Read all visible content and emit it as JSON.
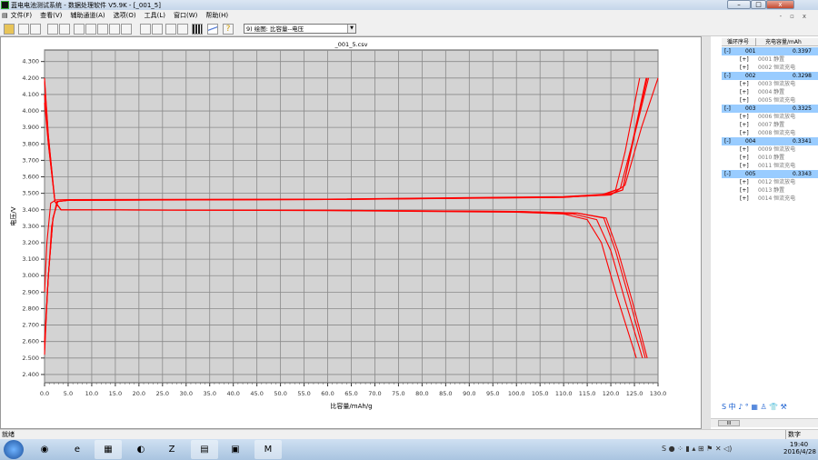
{
  "window": {
    "title": "蓝电电池测试系统 - 数据处理软件 V5.9K - [_001_5]",
    "min": "–",
    "max": "□",
    "close": "x",
    "child_min": "-",
    "child_restore": "▫",
    "child_close": "x"
  },
  "menu": [
    "文件(F)",
    "查看(V)",
    "辅助通道(A)",
    "选项(O)",
    "工具(L)",
    "窗口(W)",
    "帮助(H)"
  ],
  "toolbar": {
    "icons": [
      "open-icon",
      "back-icon",
      "forward-icon",
      "zoom-icon",
      "hand-icon",
      "h-expand-icon",
      "h-shrink-icon",
      "fit-width-icon",
      "fit-height-icon",
      "fit-all-icon",
      "copy-icon",
      "paste-icon",
      "copy2-icon",
      "paste2-icon",
      "grid-icon",
      "curve-icon",
      "help-icon"
    ],
    "plot_select": "9) 绘图: 比容量--电压"
  },
  "chart_data": {
    "type": "line",
    "title": "_001_5.csv",
    "xlabel": "比容量/mAh/g",
    "ylabel": "电压/V",
    "xlim": [
      0,
      130
    ],
    "ylim": [
      2.35,
      4.37
    ],
    "xticks": [
      "0.0",
      "5.0",
      "10.0",
      "15.0",
      "20.0",
      "25.0",
      "30.0",
      "35.0",
      "40.0",
      "45.0",
      "50.0",
      "55.0",
      "60.0",
      "65.0",
      "70.0",
      "75.0",
      "80.0",
      "85.0",
      "90.0",
      "95.0",
      "100.0",
      "105.0",
      "110.0",
      "115.0",
      "120.0",
      "125.0",
      "130.0"
    ],
    "yticks": [
      "2.400",
      "2.500",
      "2.600",
      "2.700",
      "2.800",
      "2.900",
      "3.000",
      "3.100",
      "3.200",
      "3.300",
      "3.400",
      "3.500",
      "3.600",
      "3.700",
      "3.800",
      "3.900",
      "4.000",
      "4.100",
      "4.200",
      "4.300"
    ],
    "grid": true,
    "color": "#ff0000",
    "background": "#d3d3d3",
    "series": [
      {
        "points": [
          [
            0,
            2.52
          ],
          [
            0.6,
            2.9
          ],
          [
            1.5,
            3.3
          ],
          [
            2.6,
            3.45
          ],
          [
            5,
            3.458
          ],
          [
            60,
            3.462
          ],
          [
            110,
            3.475
          ],
          [
            118,
            3.49
          ],
          [
            121,
            3.52
          ],
          [
            123,
            3.75
          ],
          [
            126.1,
            4.2
          ]
        ]
      },
      {
        "points": [
          [
            0,
            2.9
          ],
          [
            0.5,
            3.2
          ],
          [
            1.3,
            3.44
          ],
          [
            2.4,
            3.46
          ],
          [
            5,
            3.462
          ],
          [
            60,
            3.465
          ],
          [
            110,
            3.48
          ],
          [
            119,
            3.495
          ],
          [
            122,
            3.53
          ],
          [
            124.5,
            3.8
          ],
          [
            127.7,
            4.2
          ]
        ]
      },
      {
        "points": [
          [
            0,
            2.6
          ],
          [
            0.8,
            3.0
          ],
          [
            1.8,
            3.35
          ],
          [
            2.8,
            3.45
          ],
          [
            5,
            3.458
          ],
          [
            60,
            3.462
          ],
          [
            110,
            3.477
          ],
          [
            119,
            3.49
          ],
          [
            122.5,
            3.52
          ],
          [
            125,
            3.85
          ],
          [
            128,
            4.2
          ]
        ]
      },
      {
        "points": [
          [
            0,
            2.55
          ],
          [
            0.8,
            3.0
          ],
          [
            1.8,
            3.35
          ],
          [
            2.8,
            3.45
          ],
          [
            5,
            3.457
          ],
          [
            60,
            3.462
          ],
          [
            110,
            3.476
          ],
          [
            120,
            3.49
          ],
          [
            123,
            3.55
          ],
          [
            126.5,
            3.9
          ],
          [
            130,
            4.2
          ]
        ]
      },
      {
        "points": [
          [
            0,
            2.58
          ],
          [
            0.8,
            3.0
          ],
          [
            1.8,
            3.35
          ],
          [
            2.8,
            3.45
          ],
          [
            5,
            3.458
          ],
          [
            60,
            3.463
          ],
          [
            110,
            3.478
          ],
          [
            119.5,
            3.49
          ],
          [
            122.5,
            3.52
          ],
          [
            124.5,
            3.8
          ],
          [
            127.5,
            4.2
          ]
        ]
      },
      {
        "points": [
          [
            0,
            4.2
          ],
          [
            0.8,
            3.85
          ],
          [
            2.2,
            3.45
          ],
          [
            3.5,
            3.4
          ],
          [
            60,
            3.395
          ],
          [
            100,
            3.385
          ],
          [
            110,
            3.375
          ],
          [
            115,
            3.34
          ],
          [
            118,
            3.2
          ],
          [
            121,
            2.9
          ],
          [
            125.4,
            2.5
          ]
        ]
      },
      {
        "points": [
          [
            0,
            4.18
          ],
          [
            0.8,
            3.85
          ],
          [
            2.2,
            3.45
          ],
          [
            3.5,
            3.4
          ],
          [
            60,
            3.396
          ],
          [
            100,
            3.388
          ],
          [
            112,
            3.375
          ],
          [
            117,
            3.34
          ],
          [
            120,
            3.15
          ],
          [
            123,
            2.85
          ],
          [
            126.7,
            2.5
          ]
        ]
      },
      {
        "points": [
          [
            0,
            4.1
          ],
          [
            0.8,
            3.8
          ],
          [
            2.2,
            3.45
          ],
          [
            3.5,
            3.4
          ],
          [
            60,
            3.397
          ],
          [
            100,
            3.39
          ],
          [
            113,
            3.38
          ],
          [
            118.5,
            3.35
          ],
          [
            121,
            3.15
          ],
          [
            124,
            2.85
          ],
          [
            127.3,
            2.5
          ]
        ]
      },
      {
        "points": [
          [
            0,
            4.05
          ],
          [
            0.8,
            3.8
          ],
          [
            2.2,
            3.45
          ],
          [
            3.5,
            3.4
          ],
          [
            60,
            3.397
          ],
          [
            100,
            3.39
          ],
          [
            113,
            3.38
          ],
          [
            119,
            3.35
          ],
          [
            121.5,
            3.15
          ],
          [
            124.5,
            2.85
          ],
          [
            127.7,
            2.5
          ]
        ]
      }
    ]
  },
  "panel": {
    "headers": [
      "循环序号",
      "充电容量/mAh",
      ""
    ],
    "rows": [
      {
        "kind": "group",
        "toggle": "[-]",
        "id": "001",
        "value": "0.3397"
      },
      {
        "kind": "step",
        "toggle": "[+]",
        "label": "0001 静置"
      },
      {
        "kind": "step",
        "toggle": "[+]",
        "label": "0002 恒流充电"
      },
      {
        "kind": "group",
        "toggle": "[-]",
        "id": "002",
        "value": "0.3298"
      },
      {
        "kind": "step",
        "toggle": "[+]",
        "label": "0003 恒流放电"
      },
      {
        "kind": "step",
        "toggle": "[+]",
        "label": "0004 静置"
      },
      {
        "kind": "step",
        "toggle": "[+]",
        "label": "0005 恒流充电"
      },
      {
        "kind": "group",
        "toggle": "[-]",
        "id": "003",
        "value": "0.3325"
      },
      {
        "kind": "step",
        "toggle": "[+]",
        "label": "0006 恒流放电"
      },
      {
        "kind": "step",
        "toggle": "[+]",
        "label": "0007 静置"
      },
      {
        "kind": "step",
        "toggle": "[+]",
        "label": "0008 恒流充电"
      },
      {
        "kind": "group",
        "toggle": "[-]",
        "id": "004",
        "value": "0.3341"
      },
      {
        "kind": "step",
        "toggle": "[+]",
        "label": "0009 恒流放电"
      },
      {
        "kind": "step",
        "toggle": "[+]",
        "label": "0010 静置"
      },
      {
        "kind": "step",
        "toggle": "[+]",
        "label": "0011 恒流充电"
      },
      {
        "kind": "group",
        "toggle": "[-]",
        "id": "005",
        "value": "0.3343"
      },
      {
        "kind": "step",
        "toggle": "[+]",
        "label": "0012 恒流放电"
      },
      {
        "kind": "step",
        "toggle": "[+]",
        "label": "0013 静置"
      },
      {
        "kind": "step",
        "toggle": "[+]",
        "label": "0014 恒流充电"
      }
    ],
    "ime": "S 中 ♪ ° ▦ ♙ 👕 ⚒",
    "scroll_thumb": "III"
  },
  "status": {
    "left": "就绪",
    "numlock": "数字"
  },
  "taskbar": {
    "apps": [
      "media-icon",
      "ie-icon",
      "explorer-icon",
      "chart-app-icon",
      "zip-icon",
      "battery-tester-icon",
      "monitor-icon",
      "land-data-icon"
    ],
    "clock": "19:40",
    "date": "2016/4/28"
  }
}
